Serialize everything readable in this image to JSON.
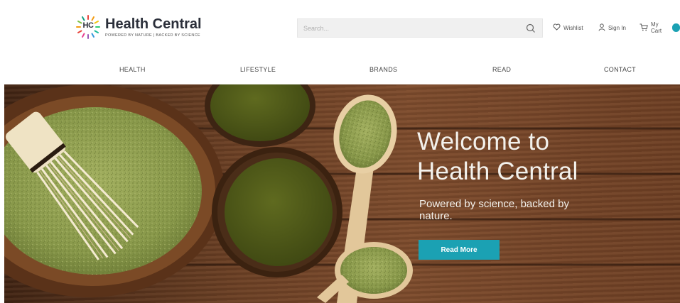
{
  "brand": {
    "initials": "HC",
    "name": "Health Central",
    "tagline": "POWERED BY NATURE | BACKED BY SCIENCE"
  },
  "search": {
    "placeholder": "Search..."
  },
  "utility": {
    "wishlist_label": "Wishlist",
    "signin_label": "Sign In",
    "cart_label": "My Cart"
  },
  "nav": {
    "items": [
      {
        "label": "HEALTH"
      },
      {
        "label": "LIFESTYLE"
      },
      {
        "label": "BRANDS"
      },
      {
        "label": "READ"
      },
      {
        "label": "CONTACT"
      }
    ]
  },
  "hero": {
    "title_line1": "Welcome to",
    "title_line2": "Health Central",
    "subtitle": "Powered by science, backed by nature.",
    "button_label": "Read More"
  },
  "colors": {
    "accent": "#1ba1b3",
    "text_dark": "#2b2f3a",
    "matcha": "#8c9a4f",
    "wood": "#6a3f24"
  },
  "icons": [
    "search-icon",
    "heart-icon",
    "user-icon",
    "cart-icon"
  ]
}
